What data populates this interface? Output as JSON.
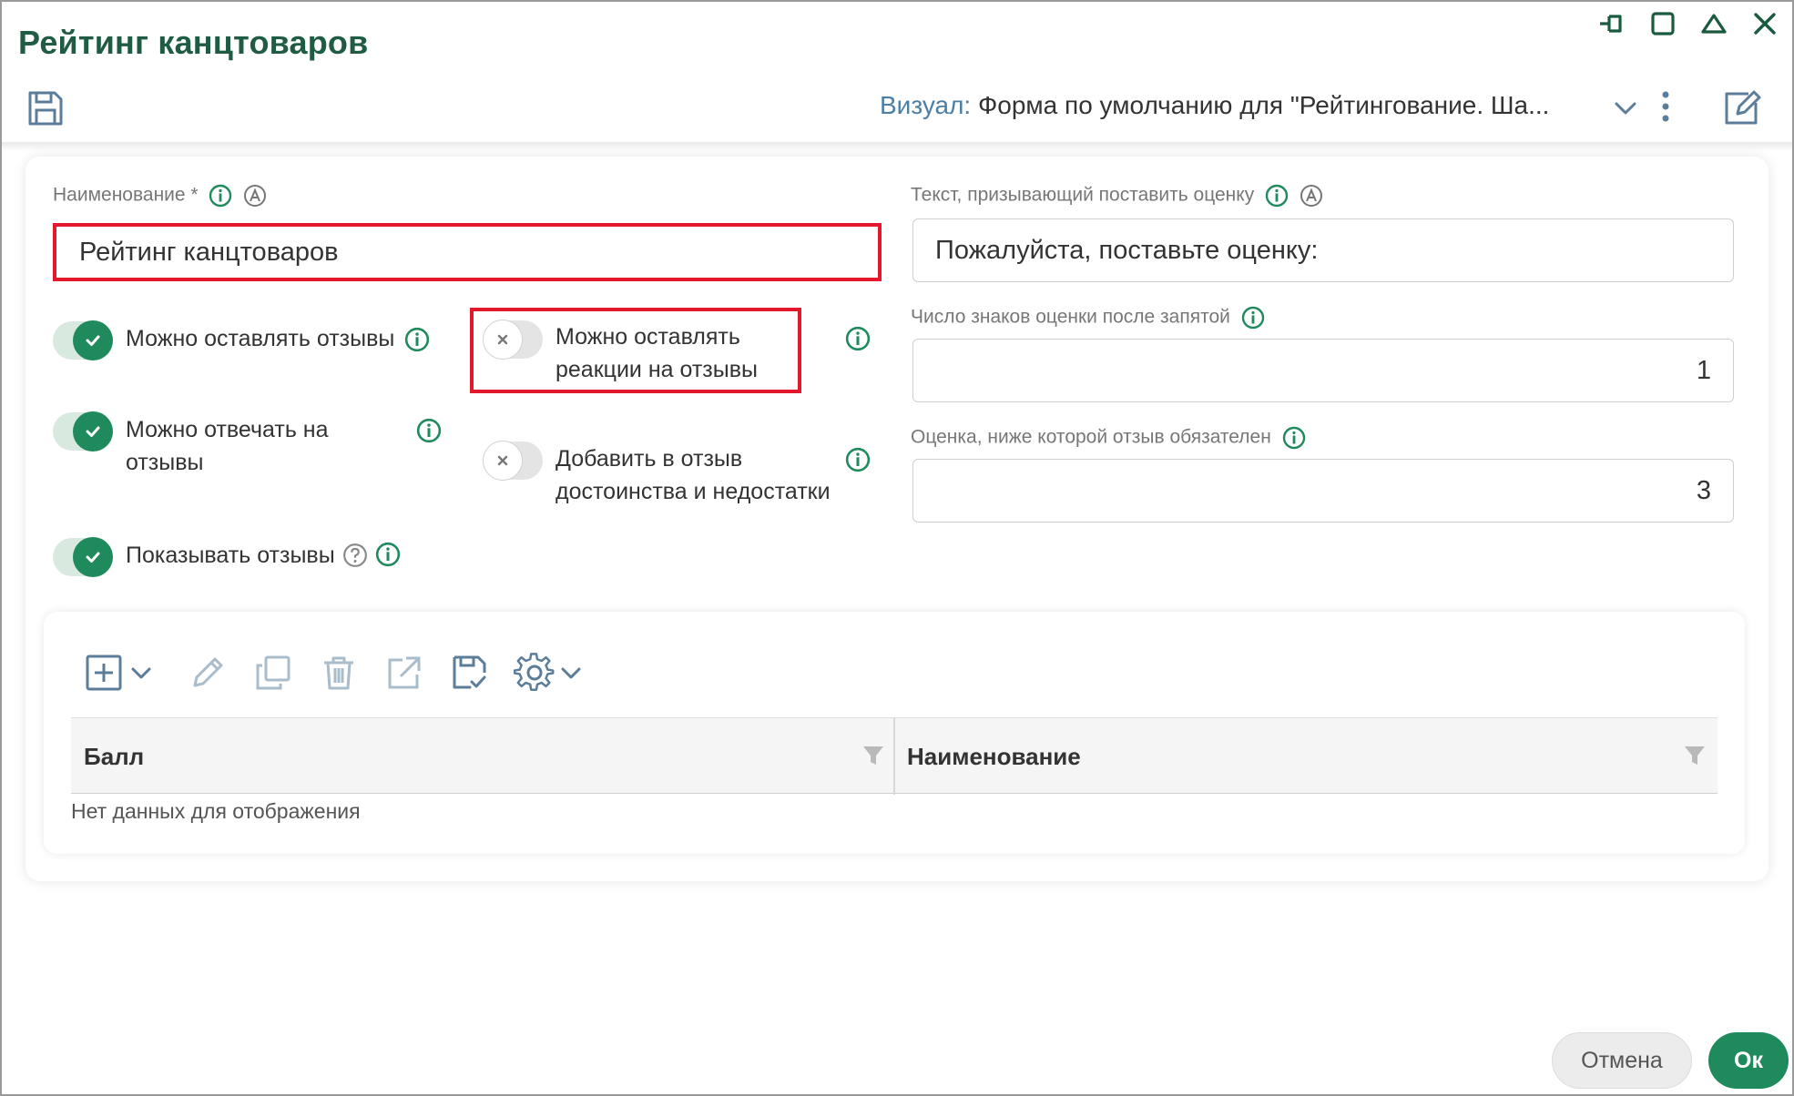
{
  "window": {
    "title": "Рейтинг канцтоваров",
    "controls": [
      "pin-icon",
      "maximize-icon",
      "collapse-icon",
      "close-icon"
    ]
  },
  "toolbar": {
    "visual_label": "Визуал:",
    "visual_value": "Форма по умолчанию для \"Рейтингование. Ша..."
  },
  "form": {
    "name_label": "Наименование *",
    "name_value": "Рейтинг канцтоваров",
    "prompt_label": "Текст, призывающий поставить оценку",
    "prompt_value": "Пожалуйста, поставьте оценку:",
    "decimals_label": "Число знаков оценки после запятой",
    "decimals_value": "1",
    "threshold_label": "Оценка, ниже которой отзыв обязателен",
    "threshold_value": "3",
    "toggles": {
      "allow_reviews": {
        "label": "Можно оставлять отзывы",
        "on": true
      },
      "allow_reactions": {
        "line1": "Можно оставлять",
        "line2": "реакции на отзывы",
        "on": false
      },
      "allow_replies": {
        "line1": "Можно отвечать на",
        "line2": "отзывы",
        "on": true
      },
      "add_pros_cons": {
        "line1": "Добавить в отзыв",
        "line2": "достоинства и недостатки",
        "on": false
      },
      "show_reviews": {
        "label": "Показывать отзывы",
        "on": true
      }
    }
  },
  "grid": {
    "toolbar_icons": [
      "add-icon",
      "chevron-down-icon",
      "edit-icon",
      "copy-icon",
      "delete-icon",
      "open-external-icon",
      "save-check-icon",
      "settings-icon",
      "chevron-down-icon"
    ],
    "columns": [
      "Балл",
      "Наименование"
    ],
    "empty_text": "Нет данных для отображения"
  },
  "footer": {
    "cancel_label": "Отмена",
    "ok_label": "Ок"
  },
  "colors": {
    "title": "#1f5c43",
    "accent": "#1f8a5c",
    "visual_label": "#4b7fa6",
    "highlight": "#e3182d",
    "icon_gray": "#5c7d9a"
  }
}
